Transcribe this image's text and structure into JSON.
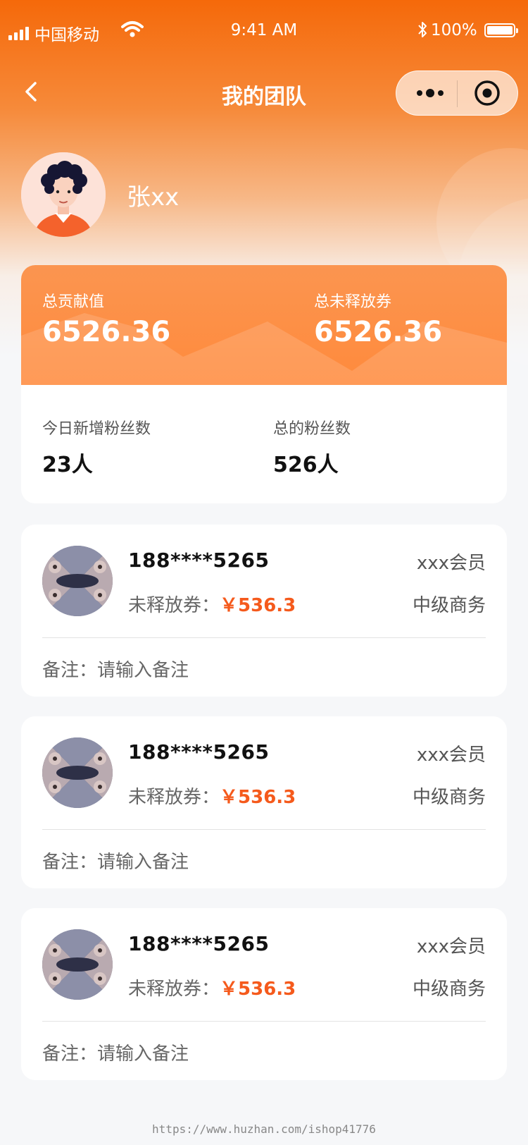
{
  "status_bar": {
    "carrier": "中国移动",
    "time": "9:41 AM",
    "battery": "100%"
  },
  "nav": {
    "title": "我的团队",
    "icons": [
      "back-arrow-icon",
      "more-icon",
      "close-target-icon"
    ]
  },
  "profile": {
    "name": "张xx"
  },
  "stats": {
    "total_contribution_label": "总贡献值",
    "total_contribution_value": "6526.36",
    "total_unreleased_label": "总未释放券",
    "total_unreleased_value": "6526.36",
    "today_new_fans_label": "今日新增粉丝数",
    "today_new_fans_value": "23人",
    "total_fans_label": "总的粉丝数",
    "total_fans_value": "526人"
  },
  "members": [
    {
      "phone": "188****5265",
      "level": "xxx会员",
      "coupon_label": "未释放券：",
      "coupon_value": "￥536.3",
      "rank": "中级商务",
      "note": "备注：请输入备注"
    },
    {
      "phone": "188****5265",
      "level": "xxx会员",
      "coupon_label": "未释放券：",
      "coupon_value": "￥536.3",
      "rank": "中级商务",
      "note": "备注：请输入备注"
    },
    {
      "phone": "188****5265",
      "level": "xxx会员",
      "coupon_label": "未释放券：",
      "coupon_value": "￥536.3",
      "rank": "中级商务",
      "note": "备注：请输入备注"
    }
  ],
  "watermark": "https://www.huzhan.com/ishop41776",
  "colors": {
    "accent": "#f5690a",
    "amount": "#f55a1c"
  }
}
